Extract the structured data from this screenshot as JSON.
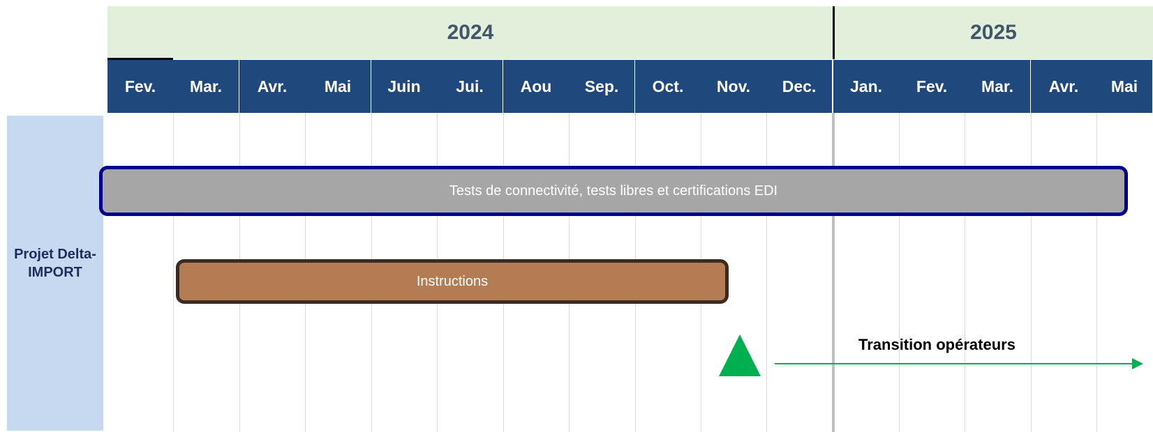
{
  "years": [
    "2024",
    "2025"
  ],
  "months": [
    "Fev.",
    "Mar.",
    "Avr.",
    "Mai",
    "Juin",
    "Jui.",
    "Aou",
    "Sep.",
    "Oct.",
    "Nov.",
    "Dec.",
    "Jan.",
    "Fev.",
    "Mar.",
    "Avr.",
    "Mai"
  ],
  "project": {
    "label": "Projet Delta-IMPORT"
  },
  "tasks": [
    {
      "label": "Tests de connectivité, tests libres et certifications EDI",
      "color": "#a6a6a6",
      "border": "#00008b"
    },
    {
      "label": "Instructions",
      "color": "#b47c52",
      "border": "#3a2a1f"
    }
  ],
  "milestone": {
    "shape": "triangle",
    "color": "#00b050"
  },
  "transition": {
    "label": "Transition opérateurs",
    "color": "#00b050"
  },
  "colors": {
    "year_header_bg": "#e2efda",
    "year_text": "#44546a",
    "month_header_bg": "#1f497d",
    "project_bg": "#c6d9f0"
  }
}
